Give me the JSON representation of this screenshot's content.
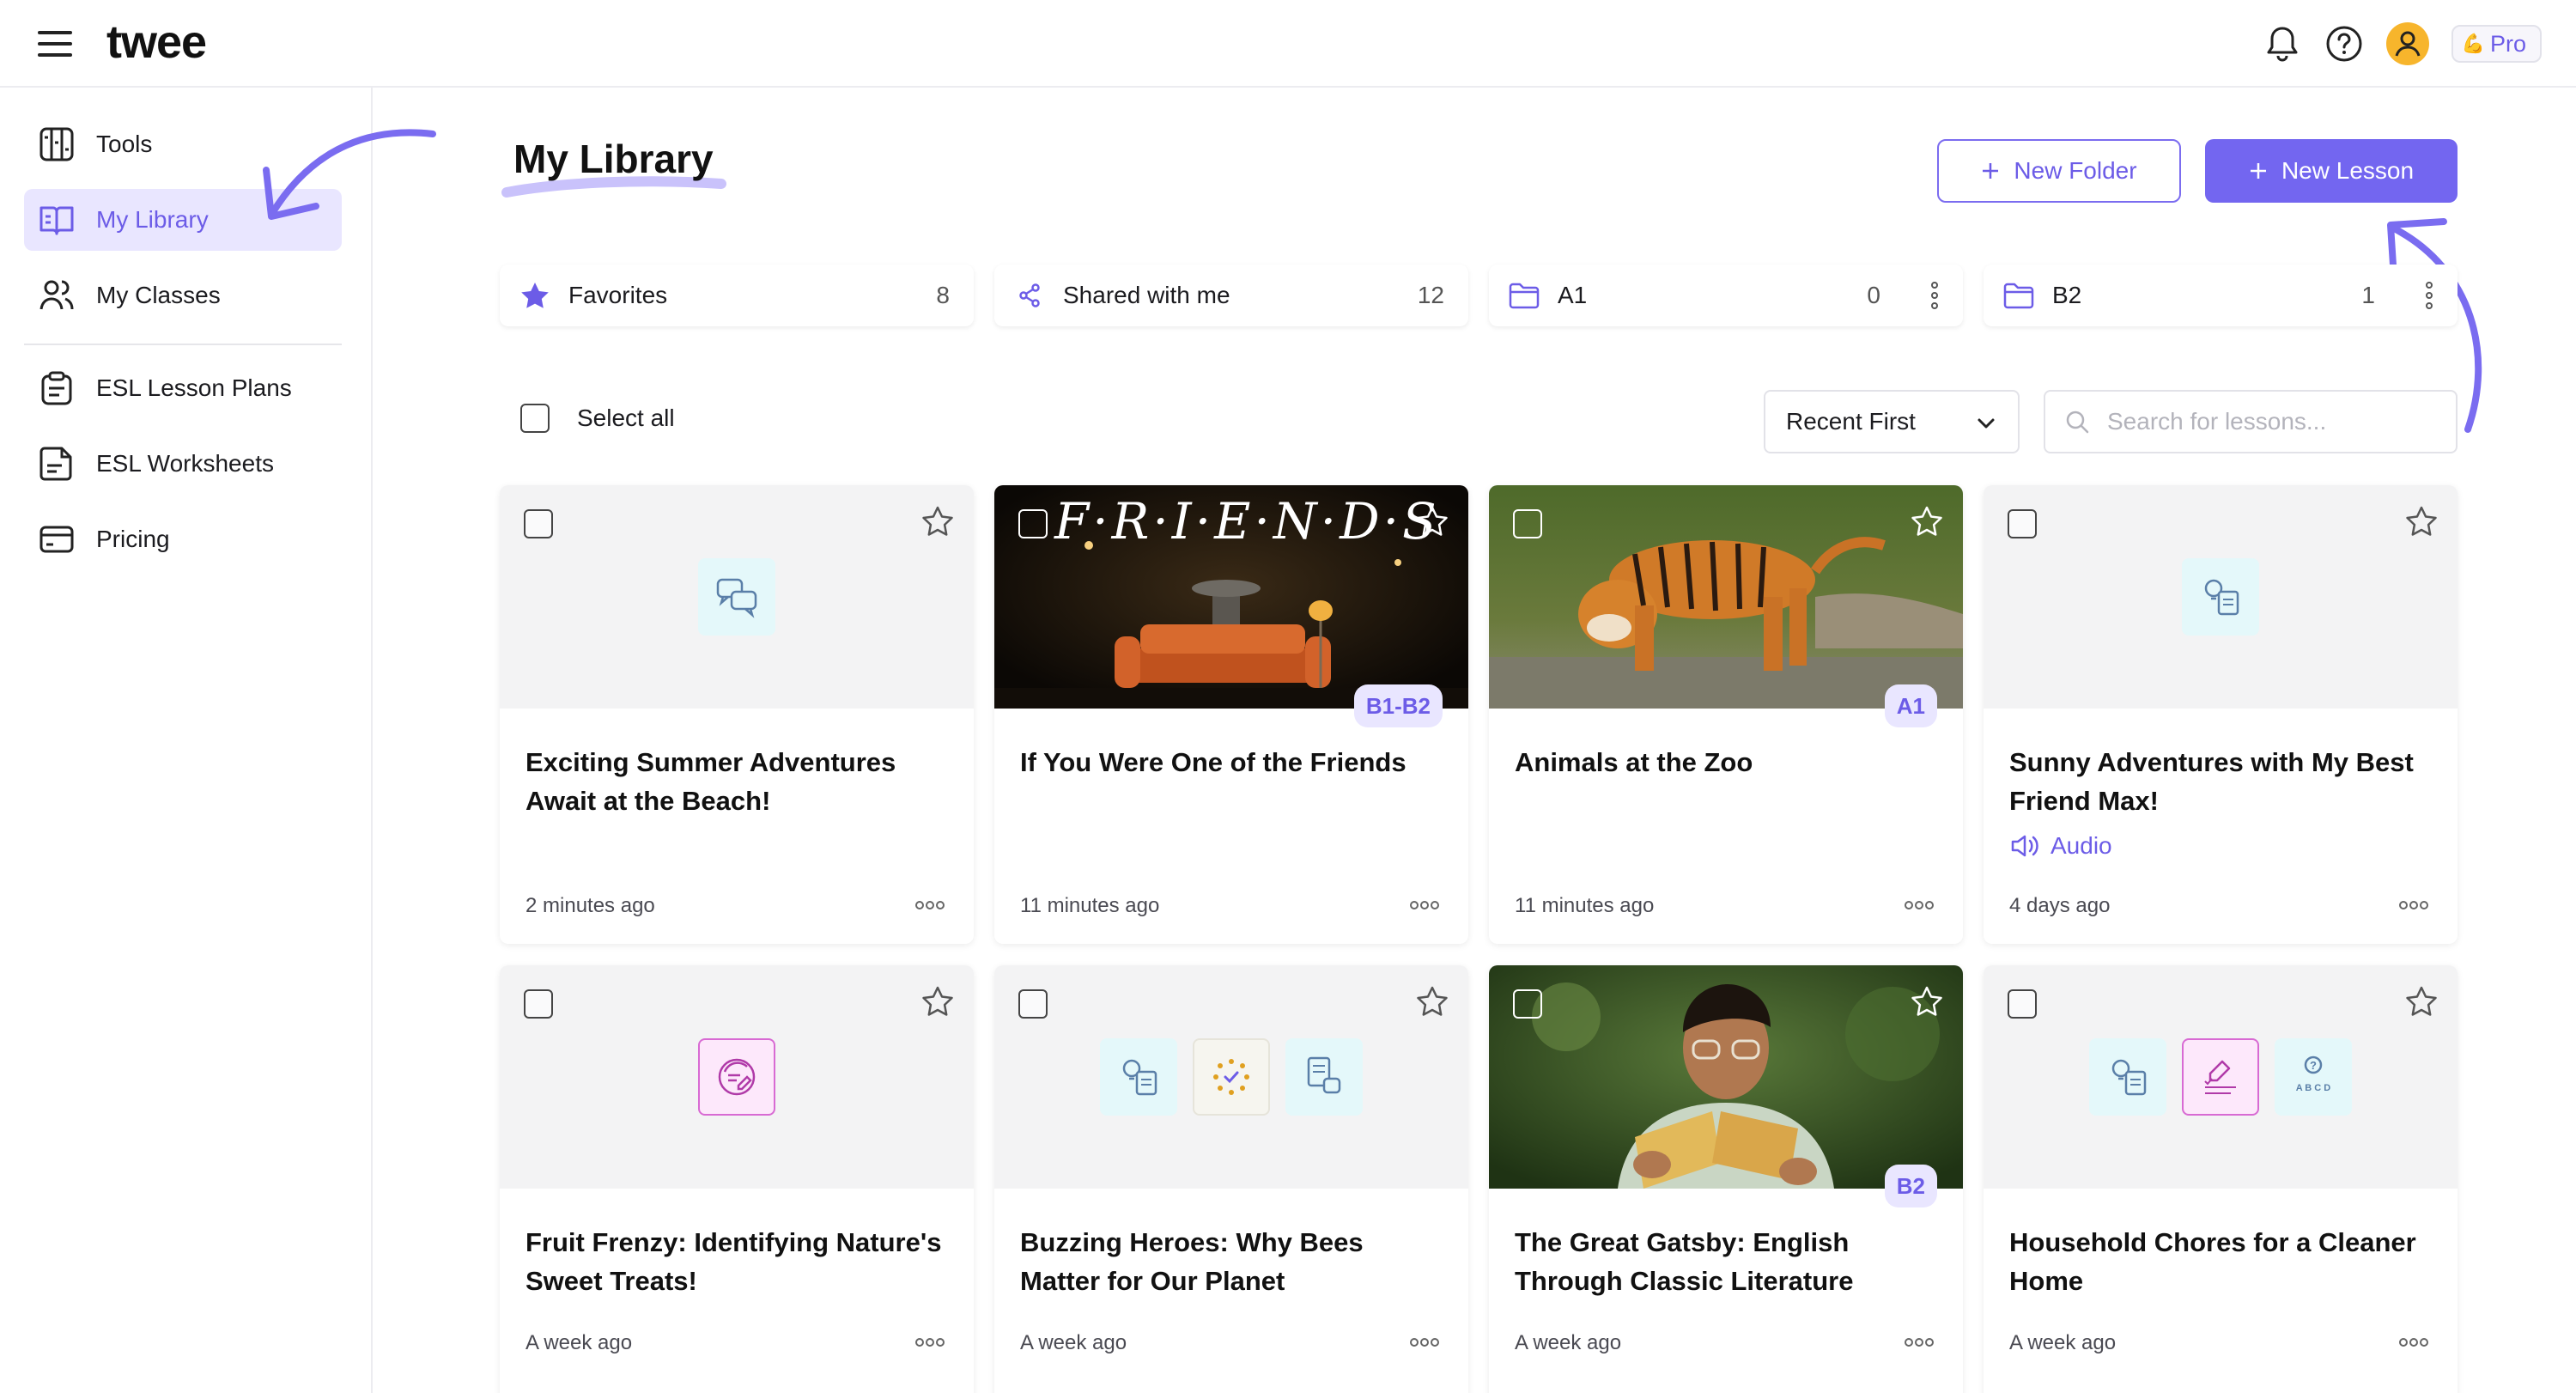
{
  "app": {
    "logo": "twee",
    "plan_label": "Pro",
    "plan_emoji": "💪"
  },
  "sidebar": {
    "items": [
      {
        "label": "Tools",
        "icon": "tools-icon",
        "active": false
      },
      {
        "label": "My Library",
        "icon": "book-open-icon",
        "active": true
      },
      {
        "label": "My Classes",
        "icon": "users-icon",
        "active": false
      },
      {
        "label": "ESL Lesson Plans",
        "icon": "clipboard-icon",
        "active": false
      },
      {
        "label": "ESL Worksheets",
        "icon": "worksheet-icon",
        "active": false
      },
      {
        "label": "Pricing",
        "icon": "credit-card-icon",
        "active": false
      }
    ]
  },
  "main": {
    "title": "My Library",
    "new_folder_label": "New Folder",
    "new_lesson_label": "New Lesson",
    "folders": [
      {
        "label": "Favorites",
        "count": "8",
        "icon": "star-filled-icon"
      },
      {
        "label": "Shared with me",
        "count": "12",
        "icon": "share-icon"
      },
      {
        "label": "A1",
        "count": "0",
        "icon": "folder-icon"
      },
      {
        "label": "B2",
        "count": "1",
        "icon": "folder-icon"
      }
    ],
    "select_all_label": "Select all",
    "sort": {
      "selected": "Recent First"
    },
    "search": {
      "placeholder": "Search for lessons..."
    },
    "lessons": [
      {
        "title": "Exciting Summer Adventures Await at the Beach!",
        "time": "2 minutes ago",
        "thumbnail": "chat-bubbles-icon",
        "level": ""
      },
      {
        "title": "If You Were One of the Friends",
        "time": "11 minutes ago",
        "thumbnail": "photo-friends",
        "thumb_text": "F·R·I·E·N·D·S",
        "level": "B1-B2"
      },
      {
        "title": "Animals at the Zoo",
        "time": "11 minutes ago",
        "thumbnail": "photo-tiger",
        "level": "A1"
      },
      {
        "title": "Sunny Adventures with My Best Friend Max!",
        "time": "4 days ago",
        "thumbnail": "idea-doc-icon",
        "level": "",
        "tag": "Audio"
      },
      {
        "title": "Fruit Frenzy: Identifying Nature's Sweet Treats!",
        "time": "A week ago",
        "thumbnail": "edit-circle-icon",
        "level": ""
      },
      {
        "title": "Buzzing Heroes: Why Bees Matter for Our Planet",
        "time": "A week ago",
        "thumbnail": "multi-tool-icons",
        "level": ""
      },
      {
        "title": "The Great Gatsby: English Through Classic Literature",
        "time": "A week ago",
        "thumbnail": "photo-reader",
        "level": "B2"
      },
      {
        "title": "Household Chores for a Cleaner Home",
        "time": "A week ago",
        "thumbnail": "multi-tool-icons",
        "thumb_text": "A B C D",
        "level": ""
      }
    ]
  },
  "colors": {
    "accent": "#6C5CE7",
    "primary_button": "#7366F0",
    "active_nav_bg": "#E9E6FF",
    "avatar": "#F7B52C"
  }
}
